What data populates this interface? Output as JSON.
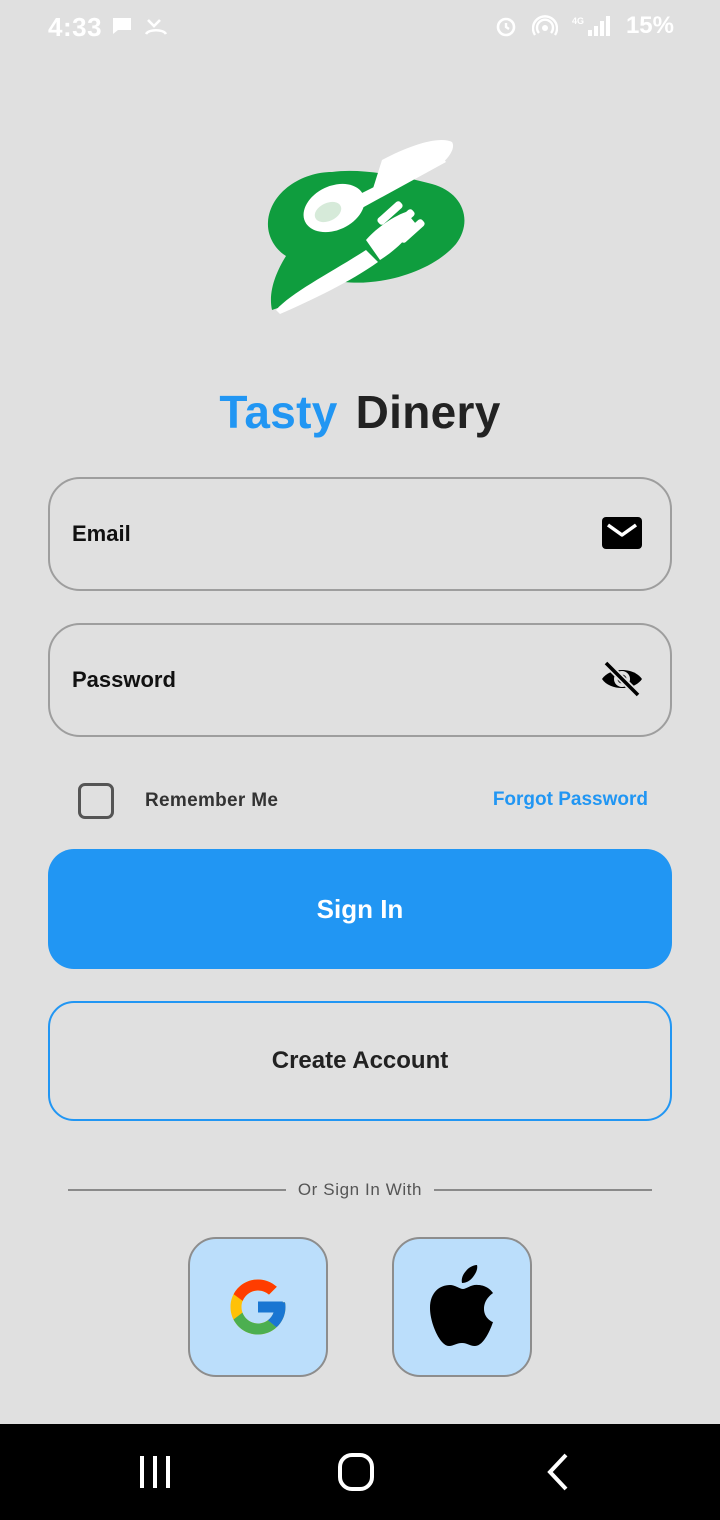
{
  "status_bar": {
    "time": "4:33",
    "battery": "15%"
  },
  "app": {
    "title_part1": "Tasty",
    "title_part2": "Dinery",
    "accent_color": "#2196f3",
    "brand_green": "#0f9d3e"
  },
  "form": {
    "email_placeholder": "Email",
    "email_icon": "mail-icon",
    "password_placeholder": "Password",
    "password_icon": "eye-off-icon",
    "remember_label": "Remember Me",
    "remember_checked": false,
    "forgot_label": "Forgot Password"
  },
  "actions": {
    "signin_label": "Sign In",
    "create_label": "Create Account"
  },
  "social": {
    "divider_text": "Or Sign In With",
    "providers": [
      "google-icon",
      "apple-icon"
    ]
  },
  "nav": {
    "buttons": [
      "recents-icon",
      "home-icon",
      "back-icon"
    ]
  }
}
